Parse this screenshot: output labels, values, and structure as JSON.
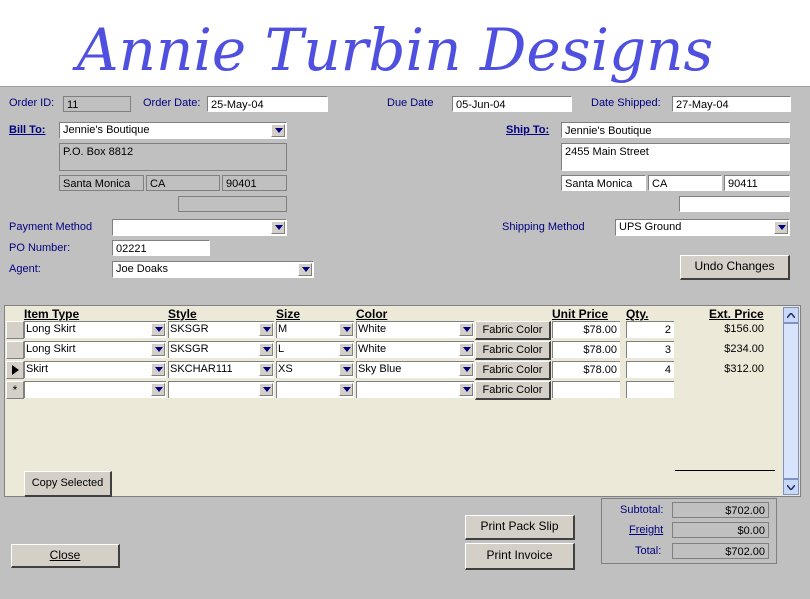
{
  "brand": {
    "title": "Annie Turbin Designs"
  },
  "header": {
    "order_id_label": "Order ID:",
    "order_id": "11",
    "order_date_label": "Order Date:",
    "order_date": "25-May-04",
    "due_date_label": "Due Date",
    "due_date": "05-Jun-04",
    "date_shipped_label": "Date Shipped:",
    "date_shipped": "27-May-04"
  },
  "bill_to": {
    "label": "Bill To:",
    "name": "Jennie's Boutique",
    "address": "P.O. Box 8812",
    "city": "Santa Monica",
    "state": "CA",
    "zip": "90401",
    "extra": ""
  },
  "ship_to": {
    "label": "Ship To:",
    "name": "Jennie's Boutique",
    "address": "2455 Main Street",
    "city": "Santa Monica",
    "state": "CA",
    "zip": "90411",
    "extra": ""
  },
  "payment": {
    "label": "Payment Method",
    "value": ""
  },
  "po": {
    "label": "PO Number:",
    "value": "02221"
  },
  "agent": {
    "label": "Agent:",
    "value": "Joe Doaks"
  },
  "shipping": {
    "label": "Shipping Method",
    "value": "UPS Ground"
  },
  "buttons": {
    "undo": "Undo Changes",
    "copy": "Copy Selected",
    "close": "Close",
    "pack_slip": "Print Pack Slip",
    "invoice": "Print Invoice",
    "fabric": "Fabric Color"
  },
  "grid": {
    "headers": {
      "item_type": "Item Type",
      "style": "Style",
      "size": "Size",
      "color": "Color",
      "unit_price": "Unit Price",
      "qty": "Qty.",
      "ext_price": "Ext. Price"
    },
    "rows": [
      {
        "item_type": "Long Skirt",
        "style": "SKSGR",
        "size": "M",
        "color": "White",
        "unit_price": "$78.00",
        "qty": "2",
        "ext_price": "$156.00"
      },
      {
        "item_type": "Long Skirt",
        "style": "SKSGR",
        "size": "L",
        "color": "White",
        "unit_price": "$78.00",
        "qty": "3",
        "ext_price": "$234.00"
      },
      {
        "item_type": "Skirt",
        "style": "SKCHAR111",
        "size": "XS",
        "color": "Sky Blue",
        "unit_price": "$78.00",
        "qty": "4",
        "ext_price": "$312.00"
      }
    ],
    "new_row_marker": "*"
  },
  "totals": {
    "subtotal_label": "Subtotal:",
    "subtotal": "$702.00",
    "freight_label": "Freight",
    "freight": "$0.00",
    "total_label": "Total:",
    "total": "$702.00"
  },
  "colors": {
    "label": "#000080",
    "logo": "#5050e0",
    "form_bg": "#c0c0c0",
    "subform_bg": "#ece9d8"
  }
}
